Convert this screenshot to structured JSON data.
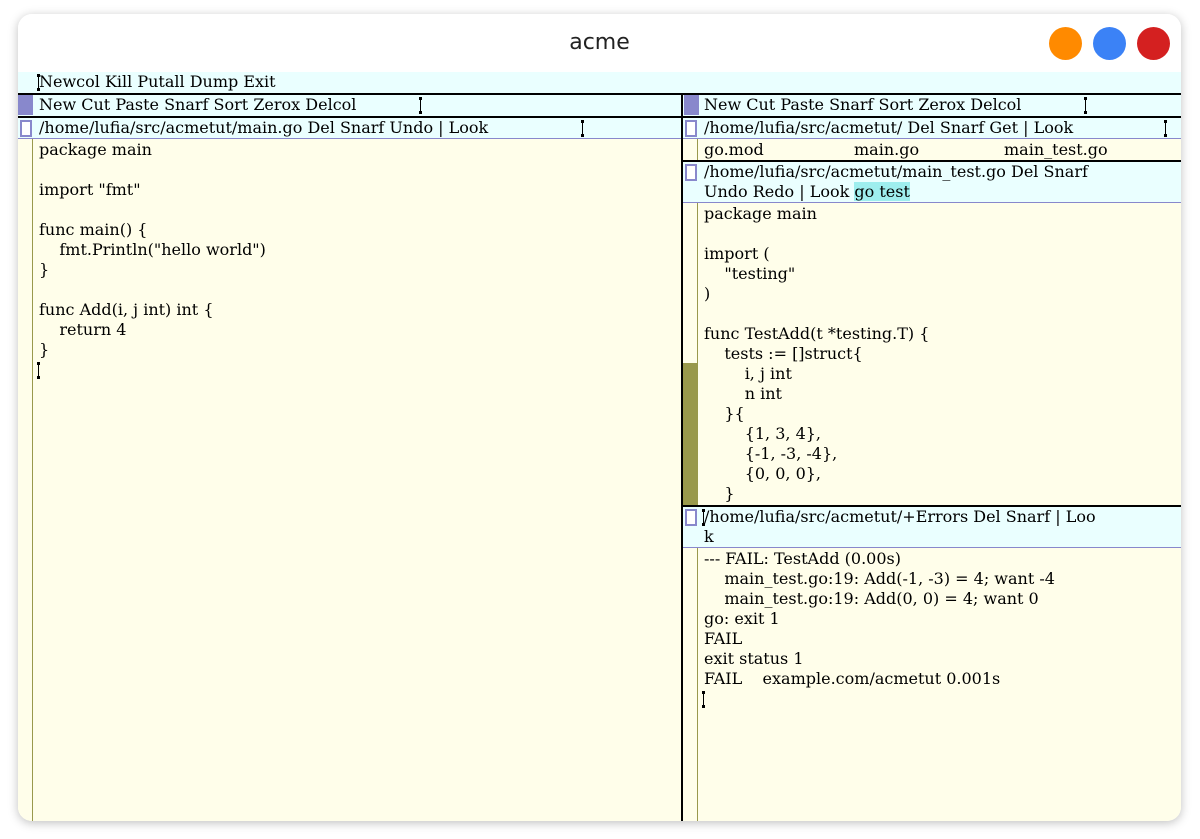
{
  "window": {
    "title": "acme",
    "buttons": {
      "minimize_color": "#ff8a00",
      "zoom_color": "#3b82f6",
      "close_color": "#d42020"
    }
  },
  "main_tag": "Newcol Kill Putall Dump Exit",
  "left_column": {
    "tag": "New Cut Paste Snarf Sort Zerox Delcol",
    "window": {
      "tag": "/home/lufia/src/acmetut/main.go Del Snarf Undo | Look",
      "body": "package main\n\nimport \"fmt\"\n\nfunc main() {\n    fmt.Println(\"hello world\")\n}\n\nfunc Add(i, j int) int {\n    return 4\n}"
    }
  },
  "right_column": {
    "tag": "New Cut Paste Snarf Sort Zerox Delcol",
    "dir_window": {
      "tag": "/home/lufia/src/acmetut/ Del Snarf Get | Look",
      "files": [
        "go.mod",
        "main.go",
        "main_test.go"
      ]
    },
    "test_window": {
      "tag_line1": "/home/lufia/src/acmetut/main_test.go Del Snarf",
      "tag_line2_prefix": "Undo Redo | Look ",
      "tag_selection": "go test",
      "body": "package main\n\nimport (\n    \"testing\"\n)\n\nfunc TestAdd(t *testing.T) {\n    tests := []struct{\n        i, j int\n        n int\n    }{\n        {1, 3, 4},\n        {-1, -3, -4},\n        {0, 0, 0},\n    }"
    },
    "errors_window": {
      "tag_line1": "/home/lufia/src/acmetut/+Errors Del Snarf | Loo",
      "tag_line2": "k",
      "body": "--- FAIL: TestAdd (0.00s)\n    main_test.go:19: Add(-1, -3) = 4; want -4\n    main_test.go:19: Add(0, 0) = 4; want 0\ngo: exit 1\nFAIL\nexit status 1\nFAIL    example.com/acmetut 0.001s"
    }
  }
}
